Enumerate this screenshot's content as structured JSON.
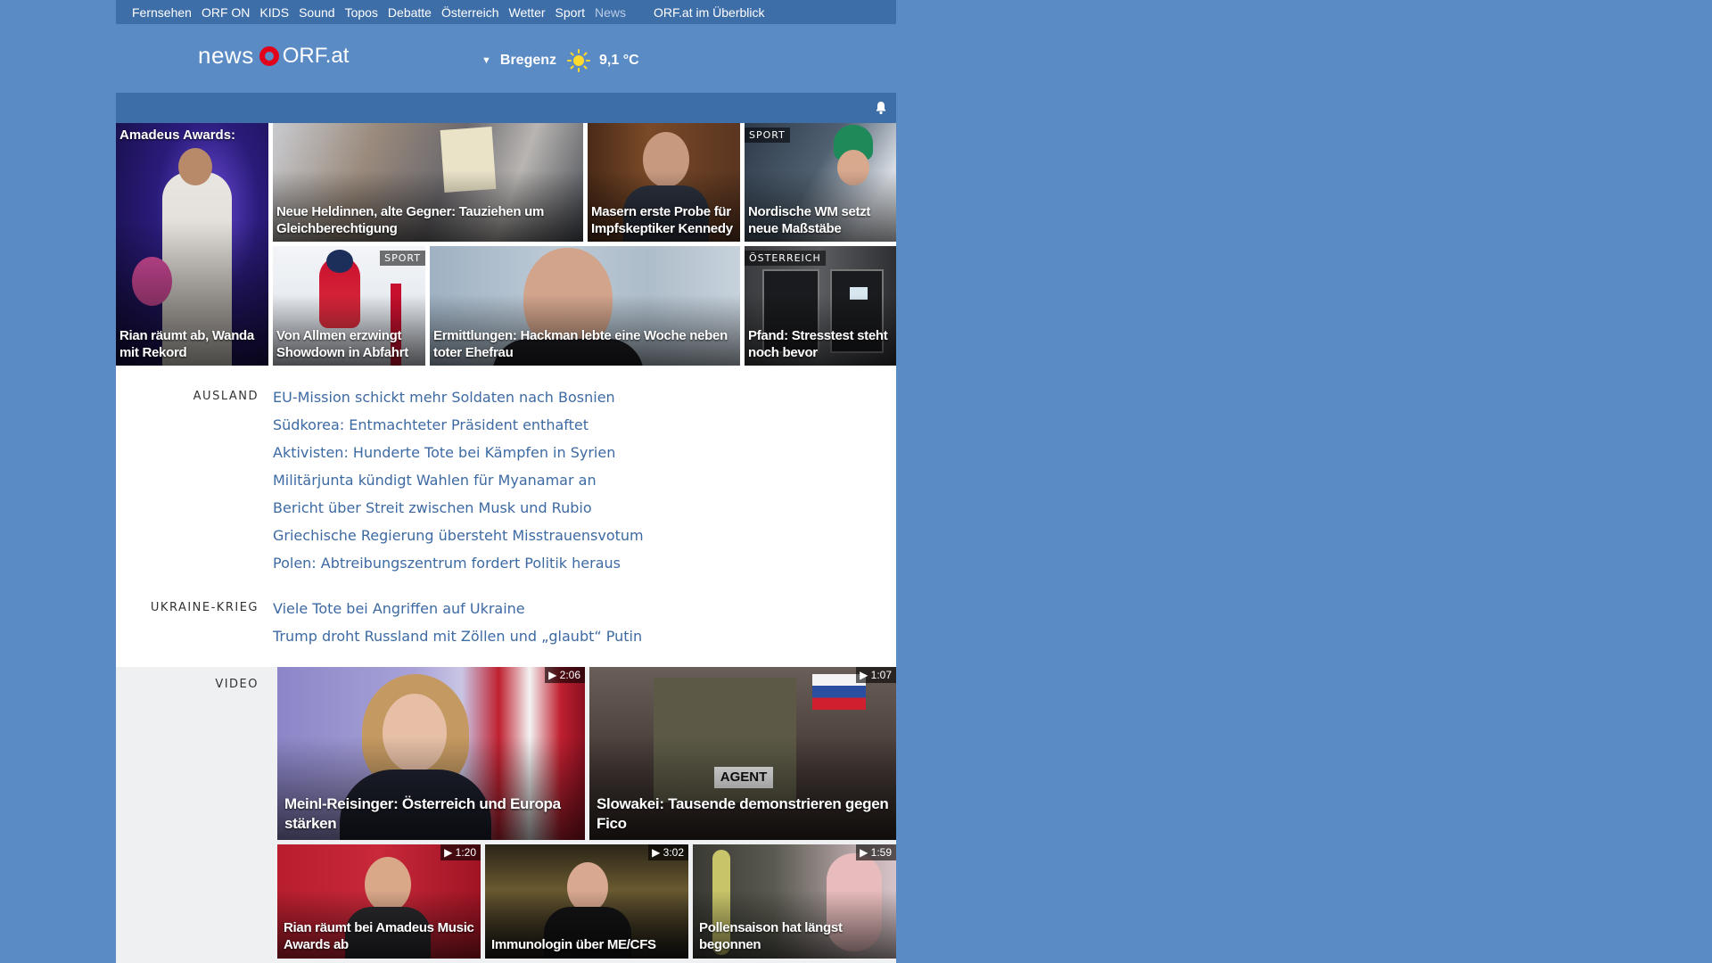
{
  "topnav": {
    "items": [
      "Fernsehen",
      "ORF ON",
      "KIDS",
      "Sound",
      "Topos",
      "Debatte",
      "Österreich",
      "Wetter",
      "Sport",
      "News"
    ],
    "overview": "ORF.at im Überblick"
  },
  "logo": {
    "news": "news",
    "orf": "ORF.at"
  },
  "weather": {
    "toggle": "▼",
    "location": "Bregenz",
    "temperature": "9,1 °C"
  },
  "tiles": {
    "amadeus": {
      "top": "Amadeus Awards:",
      "caption": "Rian räumt ab, Wanda mit Rekord"
    },
    "heldinnen": {
      "caption": "Neue Heldinnen, alte Gegner: Tauziehen um Gleichberechtigung"
    },
    "masern": {
      "caption": "Masern erste Probe für Impfskeptiker Kennedy"
    },
    "nordische": {
      "tag": "SPORT",
      "caption": "Nordische WM setzt neue Maßstäbe"
    },
    "allmen": {
      "tag": "SPORT",
      "caption": "Von Allmen erzwingt Showdown in Abfahrt"
    },
    "hackman": {
      "caption": "Ermittlungen: Hackman lebte eine Woche neben toter Ehefrau"
    },
    "pfand": {
      "tag": "ÖSTERREICH",
      "caption": "Pfand: Stresstest steht noch bevor"
    }
  },
  "ausland": {
    "label": "AUSLAND",
    "items": [
      "EU-Mission schickt mehr Soldaten nach Bosnien",
      "Südkorea: Entmachteter Präsident enthaftet",
      "Aktivisten: Hunderte Tote bei Kämpfen in Syrien",
      "Militärjunta kündigt Wahlen für Myanamar an",
      "Bericht über Streit zwischen Musk und Rubio",
      "Griechische Regierung übersteht Misstrauensvotum",
      "Polen: Abtreibungszentrum fordert Politik heraus"
    ]
  },
  "ukraine": {
    "label": "UKRAINE-KRIEG",
    "items": [
      "Viele Tote bei Angriffen auf Ukraine",
      "Trump droht Russland mit Zöllen und „glaubt“ Putin"
    ]
  },
  "video": {
    "label": "VIDEO",
    "items": [
      {
        "duration": "2:06",
        "caption": "Meinl-Reisinger: Österreich und Europa stärken"
      },
      {
        "duration": "1:07",
        "caption": "Slowakei: Tausende demonstrieren gegen Fico"
      },
      {
        "duration": "1:20",
        "caption": "Rian räumt bei Amadeus Music Awards ab"
      },
      {
        "duration": "3:02",
        "caption": "Immunologin über ME/CFS"
      },
      {
        "duration": "1:59",
        "caption": "Pollensaison hat längst begonnen"
      }
    ]
  },
  "colors": {
    "background": "#5a8bc5",
    "nav": "#3e6ea8",
    "link": "#3d6aa3",
    "brand_red": "#e2001a",
    "sun": "#ffd92b"
  }
}
